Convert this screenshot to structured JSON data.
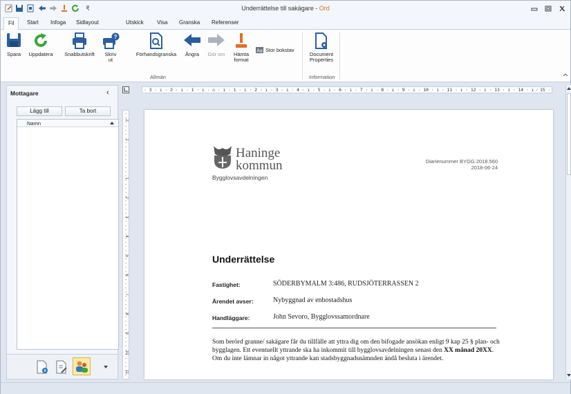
{
  "window": {
    "title_doc": "Underrättelse till sakägare",
    "title_sep": " - ",
    "title_app": "Ord"
  },
  "tabs": [
    "Fil",
    "Start",
    "Infoga",
    "Sidlayout",
    "Utskick",
    "Visa",
    "Granska",
    "Referenser"
  ],
  "ribbon": {
    "buttons": {
      "save": "Spara",
      "refresh": "Uppdatera",
      "quickprint": "Snabbutskrift",
      "print": "Skriv\nut",
      "preview": "Förhandsgranska",
      "undo": "Ångra",
      "redo": "Gör om",
      "fetch": "Hämta\nformat",
      "caps": "Stor bokstav",
      "docprops": "Document\nProperties"
    },
    "groups": {
      "general": "Allmän",
      "info": "Information"
    }
  },
  "left_panel": {
    "title": "Mottagare",
    "collapse": "‹",
    "add": "Lägg till",
    "remove": "Ta bort",
    "column": "Namn"
  },
  "ruler": {
    "horizontal": "· 3 · ı · 2 · ı · 1 · ı · ⌂ · ı · 1 · ı · 2 · ı · 3 · ı · 4 · ı · 5 · ı · 6 · ı · 7 · ı · 8 · ı · 9 · ı · 10 · ı · 11 · ı · 12 · ı · 13 · ı · 14 · ı ⁄ 15 · ı · 16 · ı · 17 · ı",
    "vertical_ticks": [
      "2",
      "1",
      "",
      "1",
      "2",
      "3",
      "4",
      "5",
      "6",
      "7",
      "8",
      "9",
      "10",
      "11"
    ]
  },
  "document": {
    "logo_line1": "Haninge",
    "logo_line2": "kommun",
    "department": "Bygglovsavdelningen",
    "diarie_number": "Diarienummer BYGG.2018.560",
    "date": "2018-06-24",
    "heading": "Underrättelse",
    "fields": [
      {
        "label": "Fastighet:",
        "value": "SÖDERBYMALM 3:486, RUDSJÖTERRASSEN 2"
      },
      {
        "label": "Ärendet avser:",
        "value": "Nybyggnad av enbostadshus"
      },
      {
        "label": "Handläggare:",
        "value": "John Sevoro, Bygglovssamordnare"
      }
    ],
    "body_1": "Som berörd granne/ sakägare får du tillfälle att yttra dig om den bifogade ansökan enligt 9 kap 25 § plan- och bygglagen. Ett eventuellt yttrande ska ha inkommit till bygglovsavdelningen senast den ",
    "body_bold": "XX månad 20XX",
    "body_2": ". Om du inte lämnar in något yttrande kan stadsbyggnadsnämnden ändå besluta i ärendet."
  },
  "colors": {
    "accent": "#2a7abf",
    "orange": "#e07020",
    "green": "#3aa33a",
    "background": "#dfe6ef"
  }
}
